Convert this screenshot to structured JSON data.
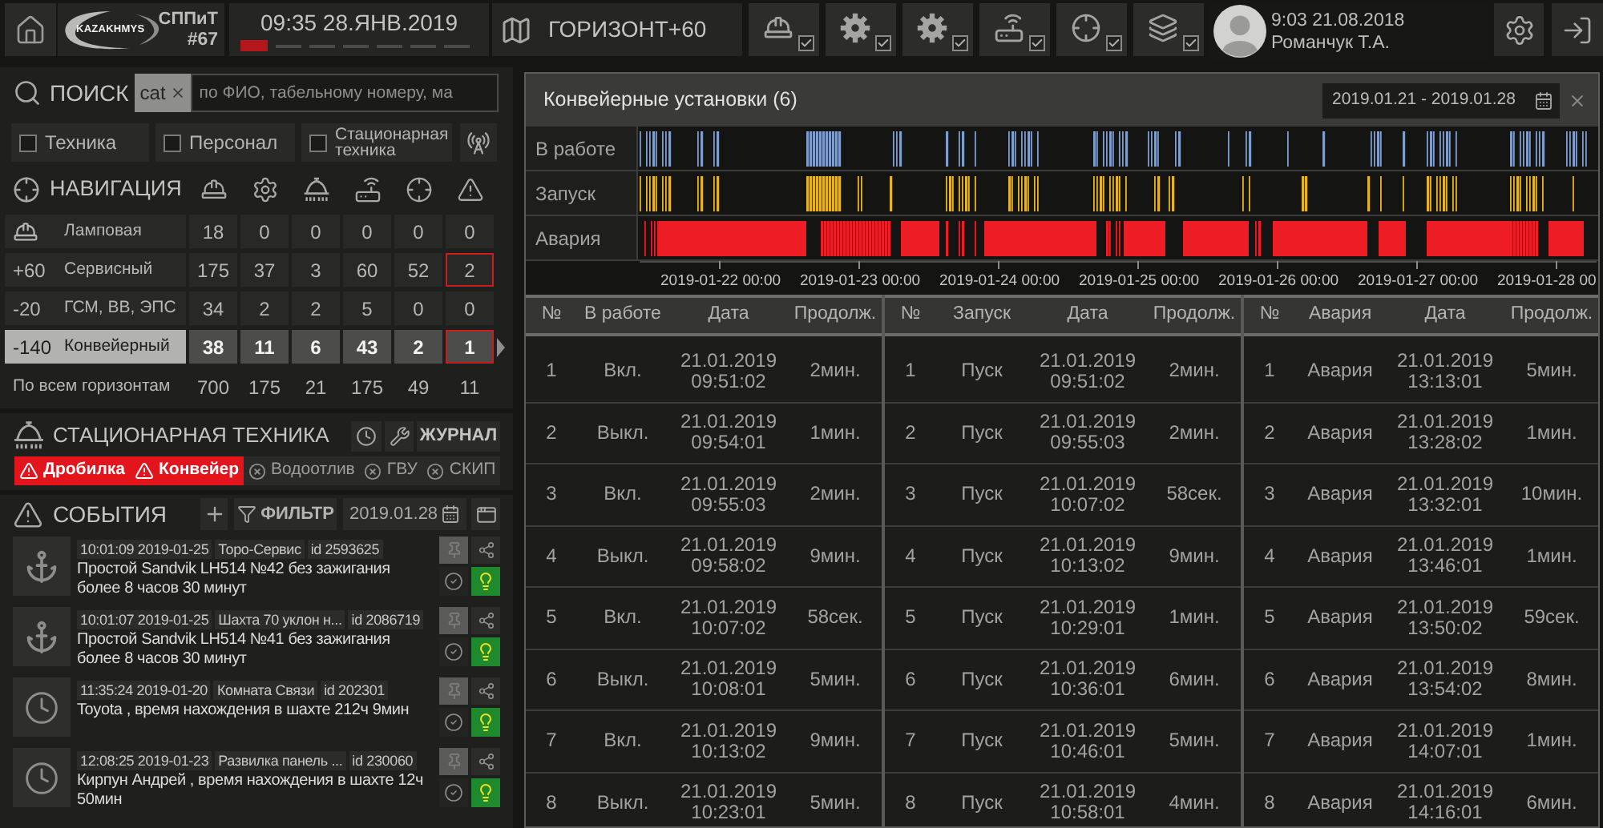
{
  "top_bar": {
    "logo": "KAZAKHMYS",
    "unit": "СППиТ",
    "unit_number": "#67",
    "clock": "09:35 28.ЯНВ.2019",
    "steps": [
      {
        "active": true
      },
      {
        "active": false
      },
      {
        "active": false
      },
      {
        "active": false
      },
      {
        "active": false
      },
      {
        "active": false
      },
      {
        "active": false
      }
    ],
    "horizon": "ГОРИЗОНТ+60",
    "layer_toggles": [
      {
        "checked": true
      },
      {
        "checked": true
      },
      {
        "checked": true
      },
      {
        "checked": true
      },
      {
        "checked": true
      },
      {
        "checked": true
      }
    ],
    "user": {
      "time": "9:03 21.08.2018",
      "name": "Романчук Т.А."
    }
  },
  "search": {
    "label": "ПОИСК",
    "chip": "cat",
    "placeholder": "по ФИО, табельному номеру, ма"
  },
  "filters": [
    {
      "label": "Техника",
      "checked": false
    },
    {
      "label": "Персонал",
      "checked": false
    },
    {
      "label": "Стационарная техника",
      "checked": false
    }
  ],
  "navigation": {
    "title": "НАВИГАЦИЯ",
    "rows": [
      {
        "kind": "lamp",
        "name": "Ламповая",
        "selected": false,
        "cells": [
          {
            "text": "18",
            "alert": false
          },
          {
            "text": "0",
            "alert": false
          },
          {
            "text": "0",
            "alert": false
          },
          {
            "text": "0",
            "alert": false
          },
          {
            "text": "0",
            "alert": false
          },
          {
            "text": "0",
            "alert": false
          }
        ]
      },
      {
        "kind": "horizon",
        "horizon": "+60",
        "name": "Сервисный",
        "selected": false,
        "cells": [
          {
            "text": "175",
            "alert": false
          },
          {
            "text": "37",
            "alert": false
          },
          {
            "text": "3",
            "alert": false
          },
          {
            "text": "60",
            "alert": false
          },
          {
            "text": "52",
            "alert": false
          },
          {
            "text": "2",
            "alert": true
          }
        ]
      },
      {
        "kind": "horizon",
        "horizon": "-20",
        "name": "ГСМ, ВВ, ЭПС",
        "selected": false,
        "cells": [
          {
            "text": "34",
            "alert": false
          },
          {
            "text": "2",
            "alert": false
          },
          {
            "text": "2",
            "alert": false
          },
          {
            "text": "5",
            "alert": false
          },
          {
            "text": "0",
            "alert": false
          },
          {
            "text": "0",
            "alert": false
          }
        ]
      },
      {
        "kind": "horizon",
        "horizon": "-140",
        "name": "Конвейерный",
        "selected": true,
        "cells": [
          {
            "text": "38",
            "alert": false
          },
          {
            "text": "11",
            "alert": false
          },
          {
            "text": "6",
            "alert": false
          },
          {
            "text": "43",
            "alert": false
          },
          {
            "text": "2",
            "alert": false
          },
          {
            "text": "1",
            "alert": true
          }
        ]
      }
    ],
    "total": {
      "label": "По всем горизонтам",
      "values": [
        "700",
        "175",
        "21",
        "175",
        "49",
        "11"
      ]
    }
  },
  "stationary": {
    "title": "СТАЦИОНАРНАЯ ТЕХНИКА",
    "journal": "ЖУРНАЛ",
    "units": [
      {
        "label": "Дробилка",
        "alarm": true
      },
      {
        "label": "Конвейер",
        "alarm": true
      },
      {
        "label": "Водоотлив",
        "alarm": false
      },
      {
        "label": "ГВУ",
        "alarm": false
      },
      {
        "label": "СКИП",
        "alarm": false
      }
    ]
  },
  "events": {
    "title": "СОБЫТИЯ",
    "filter": "ФИЛЬТР",
    "date": "2019.01.28",
    "items": [
      {
        "kind": "idle",
        "time": "10:01:09 2019-01-25",
        "place": "Торо-Сервис",
        "id": "id 2593625",
        "message": "Простой Sandvik LH514 №42 без зажигания более 8 часов 30 минут"
      },
      {
        "kind": "idle",
        "time": "10:01:07 2019-01-25",
        "place": "Шахта 70 уклон н...",
        "id": "id 2086719",
        "message": "Простой Sandvik LH514 №41 без зажигания более 8 часов 30 минут"
      },
      {
        "kind": "duration",
        "time": "11:35:24 2019-01-20",
        "place": "Комната Связи",
        "id": "id 202301",
        "message": "Toyota , время нахождения в шахте 212ч 9мин"
      },
      {
        "kind": "duration",
        "time": "12:08:25 2019-01-23",
        "place": "Развилка панель ...",
        "id": "id 230060",
        "message": "Кирпун Андрей , время нахождения в шахте 12ч 50мин"
      }
    ]
  },
  "conveyor_modal": {
    "title": "Конвейерные установки (6)",
    "date_range": "2019.01.21 - 2019.01.28",
    "timeline": {
      "rows": [
        {
          "label": "В работе",
          "color": "#7f9ccb"
        },
        {
          "label": "Запуск",
          "color": "#e6b41e"
        },
        {
          "label": "Авария",
          "color": "#ee1c25"
        }
      ],
      "ticks": [
        "2019-01-22 00:00",
        "2019-01-23 00:00",
        "2019-01-24 00:00",
        "2019-01-25 00:00",
        "2019-01-26 00:00",
        "2019-01-27 00:00",
        "2019-01-28 00"
      ]
    },
    "tables": [
      {
        "columns": [
          "№",
          "В работе",
          "Дата",
          "Продолж."
        ],
        "rows": [
          [
            "1",
            "Вкл.",
            "21.01.2019 09:51:02",
            "2мин."
          ],
          [
            "2",
            "Выкл.",
            "21.01.2019 09:54:01",
            "1мин."
          ],
          [
            "3",
            "Вкл.",
            "21.01.2019 09:55:03",
            "2мин."
          ],
          [
            "4",
            "Выкл.",
            "21.01.2019 09:58:02",
            "9мин."
          ],
          [
            "5",
            "Вкл.",
            "21.01.2019 10:07:02",
            "58сек."
          ],
          [
            "6",
            "Выкл.",
            "21.01.2019 10:08:01",
            "5мин."
          ],
          [
            "7",
            "Вкл.",
            "21.01.2019 10:13:02",
            "9мин."
          ],
          [
            "8",
            "Выкл.",
            "21.01.2019 10:23:01",
            "5мин."
          ]
        ]
      },
      {
        "columns": [
          "№",
          "Запуск",
          "Дата",
          "Продолж."
        ],
        "rows": [
          [
            "1",
            "Пуск",
            "21.01.2019 09:51:02",
            "2мин."
          ],
          [
            "2",
            "Пуск",
            "21.01.2019 09:55:03",
            "2мин."
          ],
          [
            "3",
            "Пуск",
            "21.01.2019 10:07:02",
            "58сек."
          ],
          [
            "4",
            "Пуск",
            "21.01.2019 10:13:02",
            "9мин."
          ],
          [
            "5",
            "Пуск",
            "21.01.2019 10:29:01",
            "1мин."
          ],
          [
            "6",
            "Пуск",
            "21.01.2019 10:36:01",
            "6мин."
          ],
          [
            "7",
            "Пуск",
            "21.01.2019 10:46:01",
            "5мин."
          ],
          [
            "8",
            "Пуск",
            "21.01.2019 10:58:01",
            "4мин."
          ]
        ]
      },
      {
        "columns": [
          "№",
          "Авария",
          "Дата",
          "Продолж."
        ],
        "rows": [
          [
            "1",
            "Авария",
            "21.01.2019 13:13:01",
            "5мин."
          ],
          [
            "2",
            "Авария",
            "21.01.2019 13:28:02",
            "1мин."
          ],
          [
            "3",
            "Авария",
            "21.01.2019 13:32:01",
            "10мин."
          ],
          [
            "4",
            "Авария",
            "21.01.2019 13:46:01",
            "1мин."
          ],
          [
            "5",
            "Авария",
            "21.01.2019 13:50:02",
            "59сек."
          ],
          [
            "6",
            "Авария",
            "21.01.2019 13:54:02",
            "8мин."
          ],
          [
            "7",
            "Авария",
            "21.01.2019 14:07:01",
            "1мин."
          ],
          [
            "8",
            "Авария",
            "21.01.2019 14:16:01",
            "6мин."
          ]
        ]
      }
    ]
  }
}
